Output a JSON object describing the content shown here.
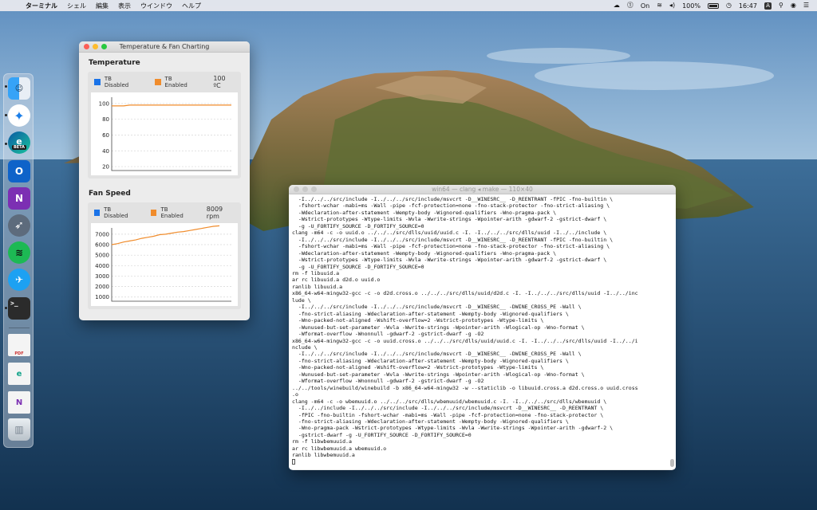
{
  "menubar": {
    "app_name": "ターミナル",
    "menus": [
      "シェル",
      "編集",
      "表示",
      "ウインドウ",
      "ヘルプ"
    ],
    "status": {
      "on_label": "On",
      "battery": "100%",
      "time": "16:47",
      "input_source": "A"
    }
  },
  "dock": {
    "apps": [
      {
        "name": "Finder",
        "icon": "finder-icon",
        "color": "#2a8cf0",
        "running": true
      },
      {
        "name": "Safari",
        "icon": "safari-icon",
        "color": "#1b7ee8",
        "running": true
      },
      {
        "name": "Edge Beta",
        "icon": "edge-beta-icon",
        "color": "#13a38a",
        "running": true,
        "badge": "BETA"
      },
      {
        "name": "Outlook",
        "icon": "outlook-icon",
        "color": "#0f63c9",
        "running": false,
        "glyph": "O"
      },
      {
        "name": "OneNote",
        "icon": "onenote-icon",
        "color": "#7c2fb3",
        "running": false,
        "glyph": "N"
      },
      {
        "name": "Launchpad",
        "icon": "rocket-icon",
        "color": "#6c7a8c",
        "running": false
      },
      {
        "name": "Spotify",
        "icon": "spotify-icon",
        "color": "#1db954",
        "running": false
      },
      {
        "name": "Twitter",
        "icon": "twitter-icon",
        "color": "#1da1f2",
        "running": false
      },
      {
        "name": "Terminal",
        "icon": "terminal-icon",
        "color": "#2b2b2b",
        "running": true,
        "glyph": ">_"
      }
    ],
    "docs": [
      {
        "icon": "pdf-document-icon",
        "label": "PDF"
      },
      {
        "icon": "edge-document-icon"
      },
      {
        "icon": "onenote-document-icon"
      },
      {
        "icon": "trash-icon"
      }
    ]
  },
  "chart_window": {
    "title": "Temperature & Fan Charting",
    "temperature": {
      "heading": "Temperature",
      "legend": [
        {
          "label": "TB Disabled",
          "color": "#1a73e8"
        },
        {
          "label": "TB Enabled",
          "color": "#f08c2c"
        }
      ],
      "current": "100 ºC"
    },
    "fan": {
      "heading": "Fan Speed",
      "legend": [
        {
          "label": "TB Disabled",
          "color": "#1a73e8"
        },
        {
          "label": "TB Enabled",
          "color": "#f08c2c"
        }
      ],
      "current": "8009 rpm"
    }
  },
  "chart_data": [
    {
      "type": "line",
      "title": "Temperature",
      "xlabel": "",
      "ylabel": "",
      "yticks": [
        20,
        40,
        60,
        80,
        100
      ],
      "ylim": [
        15,
        108
      ],
      "xlim": [
        0,
        100
      ],
      "grid": true,
      "series": [
        {
          "name": "TB Enabled",
          "color": "#f08c2c",
          "x": [
            0,
            10,
            15,
            20,
            30,
            40,
            50,
            60,
            70,
            80,
            90,
            100
          ],
          "y": [
            97,
            97,
            98,
            98,
            98,
            98,
            98,
            98,
            98,
            98,
            98,
            98
          ]
        }
      ]
    },
    {
      "type": "line",
      "title": "Fan Speed",
      "xlabel": "",
      "ylabel": "",
      "yticks": [
        1000,
        2000,
        3000,
        4000,
        5000,
        6000,
        7000
      ],
      "ylim": [
        600,
        7600
      ],
      "xlim": [
        0,
        100
      ],
      "grid": true,
      "series": [
        {
          "name": "TB Enabled",
          "color": "#f08c2c",
          "x": [
            0,
            5,
            10,
            15,
            20,
            25,
            30,
            35,
            40,
            45,
            50,
            55,
            60,
            65,
            70,
            75,
            80,
            85,
            90
          ],
          "y": [
            6000,
            6100,
            6250,
            6350,
            6450,
            6600,
            6700,
            6800,
            6950,
            7000,
            7100,
            7200,
            7250,
            7350,
            7450,
            7550,
            7650,
            7750,
            7800
          ]
        }
      ]
    }
  ],
  "terminal_window": {
    "title": "win64 — clang ◂ make — 110×40",
    "lines": [
      "  -I../../../src/include -I../../../src/include/msvcrt -D__WINESRC__ -D_REENTRANT -fPIC -fno-builtin \\",
      "  -fshort-wchar -mabi=ms -Wall -pipe -fcf-protection=none -fno-stack-protector -fno-strict-aliasing \\",
      "  -Wdeclaration-after-statement -Wempty-body -Wignored-qualifiers -Wno-pragma-pack \\",
      "  -Wstrict-prototypes -Wtype-limits -Wvla -Wwrite-strings -Wpointer-arith -gdwarf-2 -gstrict-dwarf \\",
      "  -g -U_FORTIFY_SOURCE -D_FORTIFY_SOURCE=0",
      "clang -m64 -c -o uuid.o ../../../src/dlls/uuid/uuid.c -I. -I../../../src/dlls/uuid -I../../include \\",
      "  -I../../../src/include -I../../../src/include/msvcrt -D__WINESRC__ -D_REENTRANT -fPIC -fno-builtin \\",
      "  -fshort-wchar -mabi=ms -Wall -pipe -fcf-protection=none -fno-stack-protector -fno-strict-aliasing \\",
      "  -Wdeclaration-after-statement -Wempty-body -Wignored-qualifiers -Wno-pragma-pack \\",
      "  -Wstrict-prototypes -Wtype-limits -Wvla -Wwrite-strings -Wpointer-arith -gdwarf-2 -gstrict-dwarf \\",
      "  -g -U_FORTIFY_SOURCE -D_FORTIFY_SOURCE=0",
      "rm -f libuuid.a",
      "ar rc libuuid.a d2d.o uuid.o",
      "ranlib libuuid.a",
      "x86_64-w64-mingw32-gcc -c -o d2d.cross.o ../../../src/dlls/uuid/d2d.c -I. -I../../../src/dlls/uuid -I../../inc",
      "lude \\",
      "  -I../../../src/include -I../../../src/include/msvcrt -D__WINESRC__ -DWINE_CROSS_PE -Wall \\",
      "  -fno-strict-aliasing -Wdeclaration-after-statement -Wempty-body -Wignored-qualifiers \\",
      "  -Wno-packed-not-aligned -Wshift-overflow=2 -Wstrict-prototypes -Wtype-limits \\",
      "  -Wunused-but-set-parameter -Wvla -Wwrite-strings -Wpointer-arith -Wlogical-op -Wno-format \\",
      "  -Wformat-overflow -Wnonnull -gdwarf-2 -gstrict-dwarf -g -O2",
      "x86_64-w64-mingw32-gcc -c -o uuid.cross.o ../../../src/dlls/uuid/uuid.c -I. -I../../../src/dlls/uuid -I../../i",
      "nclude \\",
      "  -I../../../src/include -I../../../src/include/msvcrt -D__WINESRC__ -DWINE_CROSS_PE -Wall \\",
      "  -fno-strict-aliasing -Wdeclaration-after-statement -Wempty-body -Wignored-qualifiers \\",
      "  -Wno-packed-not-aligned -Wshift-overflow=2 -Wstrict-prototypes -Wtype-limits \\",
      "  -Wunused-but-set-parameter -Wvla -Wwrite-strings -Wpointer-arith -Wlogical-op -Wno-format \\",
      "  -Wformat-overflow -Wnonnull -gdwarf-2 -gstrict-dwarf -g -O2",
      "../../tools/winebuild/winebuild -b x86_64-w64-mingw32 -w --staticlib -o libuuid.cross.a d2d.cross.o uuid.cross",
      ".o",
      "clang -m64 -c -o wbemuuid.o ../../../src/dlls/wbemuuid/wbemuuid.c -I. -I../../../src/dlls/wbemuuid \\",
      "  -I../../include -I../../../src/include -I../../../src/include/msvcrt -D__WINESRC__ -D_REENTRANT \\",
      "  -fPIC -fno-builtin -fshort-wchar -mabi=ms -Wall -pipe -fcf-protection=none -fno-stack-protector \\",
      "  -fno-strict-aliasing -Wdeclaration-after-statement -Wempty-body -Wignored-qualifiers \\",
      "  -Wno-pragma-pack -Wstrict-prototypes -Wtype-limits -Wvla -Wwrite-strings -Wpointer-arith -gdwarf-2 \\",
      "  -gstrict-dwarf -g -U_FORTIFY_SOURCE -D_FORTIFY_SOURCE=0",
      "rm -f libwbemuuid.a",
      "ar rc libwbemuuid.a wbemuuid.o",
      "ranlib libwbemuuid.a"
    ]
  }
}
